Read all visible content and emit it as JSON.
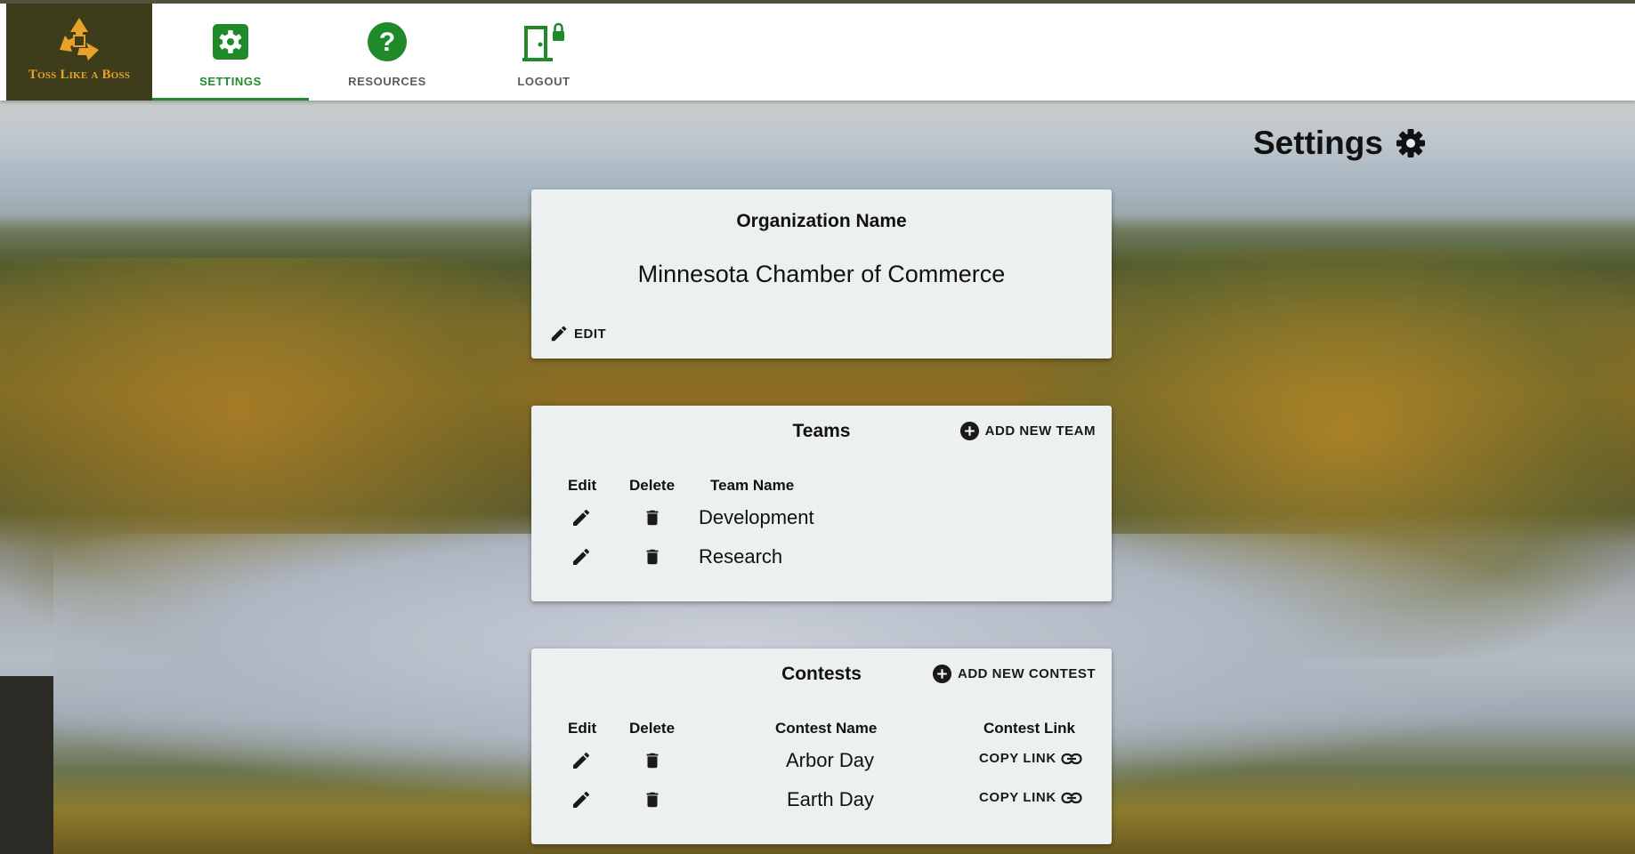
{
  "app": {
    "logo_text": "Toss Like a Boss",
    "brand_color": "#1f8a2a",
    "logo_bg": "#3d3d1c",
    "logo_accent": "#e8a22a"
  },
  "nav": {
    "tabs": [
      {
        "label": "SETTINGS",
        "icon": "gear-box-icon",
        "active": true
      },
      {
        "label": "RESOURCES",
        "icon": "help-circle-icon",
        "active": false
      },
      {
        "label": "LOGOUT",
        "icon": "door-lock-icon",
        "active": false
      }
    ]
  },
  "page": {
    "title": "Settings",
    "title_icon": "gear-icon"
  },
  "organization": {
    "heading": "Organization Name",
    "name": "Minnesota Chamber of Commerce",
    "edit_label": "EDIT"
  },
  "teams": {
    "heading": "Teams",
    "add_label": "ADD NEW TEAM",
    "columns": {
      "edit": "Edit",
      "delete": "Delete",
      "name": "Team Name"
    },
    "rows": [
      {
        "name": "Development"
      },
      {
        "name": "Research"
      }
    ]
  },
  "contests": {
    "heading": "Contests",
    "add_label": "ADD NEW CONTEST",
    "columns": {
      "edit": "Edit",
      "delete": "Delete",
      "name": "Contest Name",
      "link": "Contest Link"
    },
    "rows": [
      {
        "name": "Arbor Day",
        "link_label": "COPY LINK"
      },
      {
        "name": "Earth Day",
        "link_label": "COPY LINK"
      }
    ]
  }
}
